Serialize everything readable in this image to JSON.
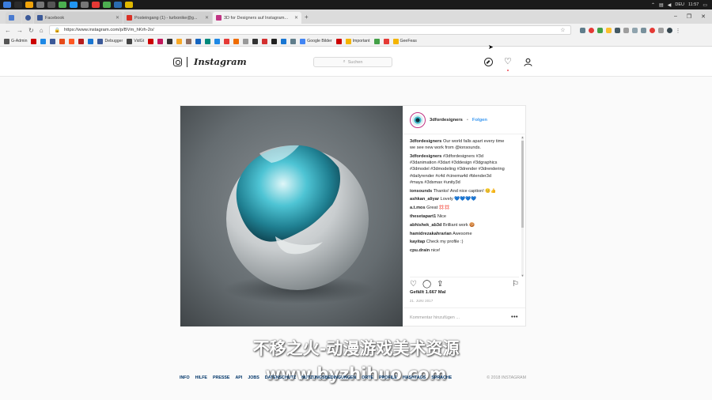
{
  "taskbar": {
    "lang": "DEU",
    "time": "11:57",
    "app_colors": [
      "#3b7ddd",
      "#2b2b2b",
      "#f0a30a",
      "#777777",
      "#555555",
      "#4caf50",
      "#2196f3",
      "#777777",
      "#e53935",
      "#4caf50",
      "#2b6cb0",
      "#e0b800"
    ]
  },
  "browser": {
    "tabs": [
      {
        "title": "Facebook",
        "favicon_color": "#3b5998",
        "active": false
      },
      {
        "title": "Posteingang (1) - turbonike@g...",
        "favicon_color": "#d93025",
        "active": false
      },
      {
        "title": "3D for Designers auf Instagram...",
        "favicon_color": "#c13584",
        "active": true
      }
    ],
    "new_tab": "+",
    "url": "https://www.instagram.com/p/BVm_hKrh-2o/",
    "bookmarks": [
      {
        "label": "G-Admin",
        "color": "#555555"
      },
      {
        "label": "",
        "color": "#cc0000"
      },
      {
        "label": "",
        "color": "#1e88e5"
      },
      {
        "label": "",
        "color": "#3b5998"
      },
      {
        "label": "",
        "color": "#e64a19"
      },
      {
        "label": "",
        "color": "#ff5722"
      },
      {
        "label": "",
        "color": "#b71c1c"
      },
      {
        "label": "",
        "color": "#1976d2"
      },
      {
        "label": "Debugger",
        "color": "#3b5998"
      },
      {
        "label": "VidGt",
        "color": "#444444"
      },
      {
        "label": "",
        "color": "#cc0000"
      },
      {
        "label": "",
        "color": "#c2185b"
      },
      {
        "label": "",
        "color": "#333333"
      },
      {
        "label": "",
        "color": "#f9a825"
      },
      {
        "label": "",
        "color": "#8d6e63"
      },
      {
        "label": "",
        "color": "#1565c0"
      },
      {
        "label": "",
        "color": "#00897b"
      },
      {
        "label": "",
        "color": "#1e88e5"
      },
      {
        "label": "",
        "color": "#e53935"
      },
      {
        "label": "",
        "color": "#ef6c00"
      },
      {
        "label": "",
        "color": "#999999"
      },
      {
        "label": "",
        "color": "#333333"
      },
      {
        "label": "",
        "color": "#d32f2f"
      },
      {
        "label": "",
        "color": "#212121"
      },
      {
        "label": "",
        "color": "#1976d2"
      },
      {
        "label": "",
        "color": "#607d8b"
      },
      {
        "label": "Google Bilder",
        "color": "#4285f4"
      },
      {
        "label": "",
        "color": "#cc0000"
      },
      {
        "label": "Important",
        "color": "#f4b400"
      },
      {
        "label": "",
        "color": "#43a047"
      },
      {
        "label": "",
        "color": "#e53935"
      },
      {
        "label": "GeeFeas",
        "color": "#f4b400"
      }
    ]
  },
  "instagram": {
    "logo_text": "Instagram",
    "search_placeholder": "Suchen",
    "post": {
      "username": "3dfordesigners",
      "dot": "•",
      "follow": "Folgen",
      "comments": [
        {
          "user": "3dfordesigners",
          "text": "Our world falls apart every time we see new work from @ionsounds."
        },
        {
          "user": "3dfordesigners",
          "text": "#3dfordesigners #3d #3danimation #3dart #3ddesign #3dgraphics #3dmodel #3dmodeling #3drender #3drendering #dailyrender #c4d #cinema4d #blender3d #maya #3dsmax #unity3d"
        },
        {
          "user": "ionsounds",
          "text": "Thanks! And nice caption! 😊👍"
        },
        {
          "user": "ashkan_aliyar",
          "text": "Lovely 💙💙💙💙"
        },
        {
          "user": "a.t.mos",
          "text": "Great 💢💢"
        },
        {
          "user": "thesetapart1",
          "text": "Nice"
        },
        {
          "user": "abhishek_ab3d",
          "text": "Brilliant work 🍪"
        },
        {
          "user": "hamidrezakahrarian",
          "text": "Awesome"
        },
        {
          "user": "kayitap",
          "text": "Check my profile :)"
        },
        {
          "user": "cpu.drain",
          "text": "nice!"
        }
      ],
      "likes": "Gefällt 1.667 Mal",
      "date": "21. JUNI 2017",
      "add_comment_placeholder": "Kommentar hinzufügen ...",
      "more": "•••"
    },
    "footer": {
      "links": [
        "INFO",
        "HILFE",
        "PRESSE",
        "API",
        "JOBS",
        "DATENSCHUTZ",
        "NUTZUNGSBEDINGUNGEN",
        "ORTE",
        "PROFILE",
        "HASHTAGS",
        "SPRACHE"
      ],
      "copyright": "© 2018 INSTAGRAM"
    }
  },
  "watermark": {
    "line1": "不移之火-动漫游戏美术资源",
    "line2": "www.byzhihuo.com"
  }
}
